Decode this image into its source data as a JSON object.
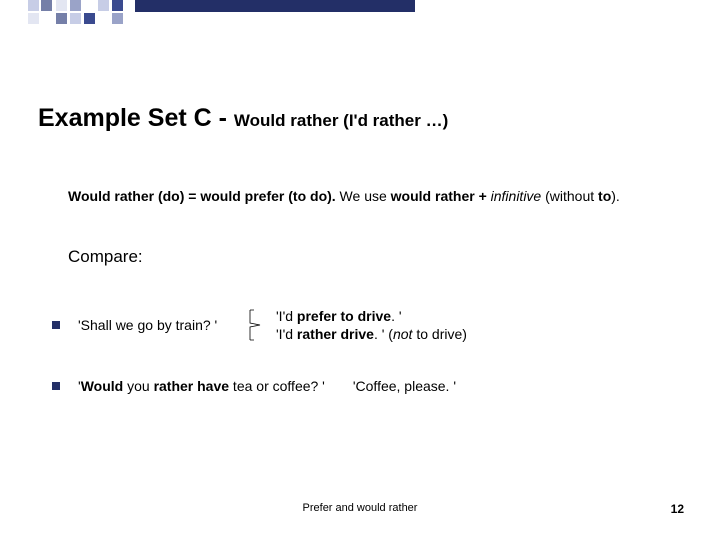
{
  "title_main": "Example Set C",
  "title_sep": " - ",
  "title_sub": "Would rather (I'd rather …)",
  "intro_html": "<b>Would rather (do) = would prefer (to do).</b> We use <b>would rather + </b><span class='it'>infinitive</span> (without <b>to</b>).",
  "compare": "Compare:",
  "r1_q": "'Shall we go by train? '",
  "r1_a1_html": "'I'd <b>prefer to drive</b>. '",
  "r1_a2_html": "'I'd <b>rather drive</b>. ' (<span class='it'>not</span> to drive)",
  "r2_q_html": "'<b>Would</b> you <b>rather have</b> tea or coffee? '",
  "r2_a": "'Coffee, please. '",
  "footer": "Prefer and would rather",
  "page": "12"
}
